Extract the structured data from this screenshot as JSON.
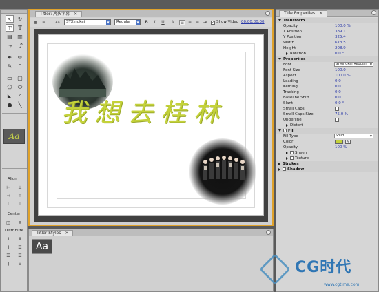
{
  "titler": {
    "tab_label": "Titler: 片头字幕",
    "font_name": "STXingkai",
    "font_style": "Regular",
    "show_video_label": "Show Video",
    "timecode": "00;00;00;00",
    "title_text": "我想去桂林"
  },
  "tools": {
    "align_label": "Align",
    "center_label": "Center",
    "distribute_label": "Distribute",
    "swatch_label": "Aa"
  },
  "styles": {
    "tab_label": "Titler Styles",
    "sample_label": "Aa"
  },
  "properties": {
    "tab_label": "Title Properties",
    "rows": [
      {
        "label": "Transform",
        "value": "",
        "type": "head",
        "open": true
      },
      {
        "label": "Opacity",
        "value": "100.0 %"
      },
      {
        "label": "X Position",
        "value": "389.1"
      },
      {
        "label": "Y Position",
        "value": "325.4"
      },
      {
        "label": "Width",
        "value": "673.5"
      },
      {
        "label": "Height",
        "value": "208.9"
      },
      {
        "label": "Rotation",
        "value": "0.0 °",
        "type": "sub"
      },
      {
        "label": "Properties",
        "value": "",
        "type": "head",
        "open": true
      },
      {
        "label": "Font",
        "value": "STXingkai Regular",
        "type": "dropdown"
      },
      {
        "label": "Font Size",
        "value": "100.0"
      },
      {
        "label": "Aspect",
        "value": "100.0 %"
      },
      {
        "label": "Leading",
        "value": "0.0"
      },
      {
        "label": "Kerning",
        "value": "0.0"
      },
      {
        "label": "Tracking",
        "value": "0.0"
      },
      {
        "label": "Baseline Shift",
        "value": "0.0"
      },
      {
        "label": "Slant",
        "value": "0.0 °"
      },
      {
        "label": "Small Caps",
        "value": "",
        "type": "check"
      },
      {
        "label": "Small Caps Size",
        "value": "75.0 %"
      },
      {
        "label": "Underline",
        "value": "",
        "type": "check"
      },
      {
        "label": "Distort",
        "value": "",
        "type": "sub"
      },
      {
        "label": "Fill",
        "value": "",
        "type": "head",
        "open": true,
        "checked": true
      },
      {
        "label": "Fill Type",
        "value": "Solid",
        "type": "dropdown"
      },
      {
        "label": "Color",
        "value": "",
        "type": "color"
      },
      {
        "label": "Opacity",
        "value": "100 %"
      },
      {
        "label": "Sheen",
        "value": "",
        "type": "subcheck"
      },
      {
        "label": "Texture",
        "value": "",
        "type": "subcheck"
      },
      {
        "label": "Strokes",
        "value": "",
        "type": "head",
        "open": false
      },
      {
        "label": "Shadow",
        "value": "",
        "type": "head",
        "open": false,
        "checked": false
      }
    ],
    "fill_color": "#c4d23a"
  },
  "watermark": {
    "brand": "CG时代",
    "url": "www.cgtime.com"
  },
  "colors": {
    "accent_border": "#e0a22a",
    "title_fill": "#c4d23a"
  }
}
